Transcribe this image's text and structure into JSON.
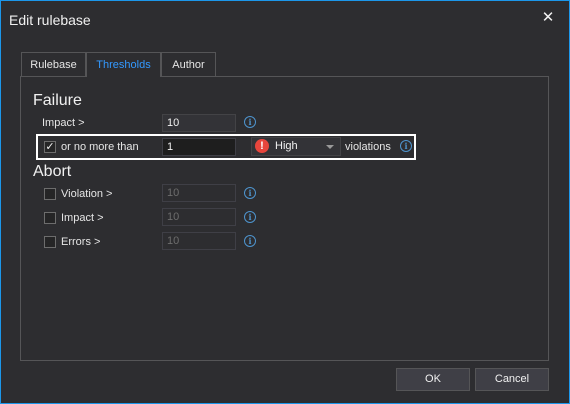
{
  "dialog": {
    "title": "Edit rulebase",
    "close_glyph": "✕"
  },
  "tabs": [
    {
      "label": "Rulebase"
    },
    {
      "label": "Thresholds",
      "active": true
    },
    {
      "label": "Author"
    }
  ],
  "failure": {
    "heading": "Failure",
    "impact_label": "Impact >",
    "impact_value": "10",
    "or_no_more_label": "or no more than",
    "or_no_more_checked": true,
    "or_no_more_value": "1",
    "severity_selected": "High",
    "violations_label": "violations"
  },
  "abort": {
    "heading": "Abort",
    "violation_label": "Violation >",
    "violation_value": "10",
    "impact_label": "Impact >",
    "impact_value": "10",
    "errors_label": "Errors >",
    "errors_value": "10"
  },
  "footer": {
    "ok_label": "OK",
    "cancel_label": "Cancel"
  },
  "colors": {
    "accent": "#3399ff",
    "window_border": "#1c97ea",
    "severity_high": "#e8453c"
  },
  "icons": {
    "info": "info-icon",
    "severity": "high-severity-icon",
    "check": "checkmark-icon"
  }
}
